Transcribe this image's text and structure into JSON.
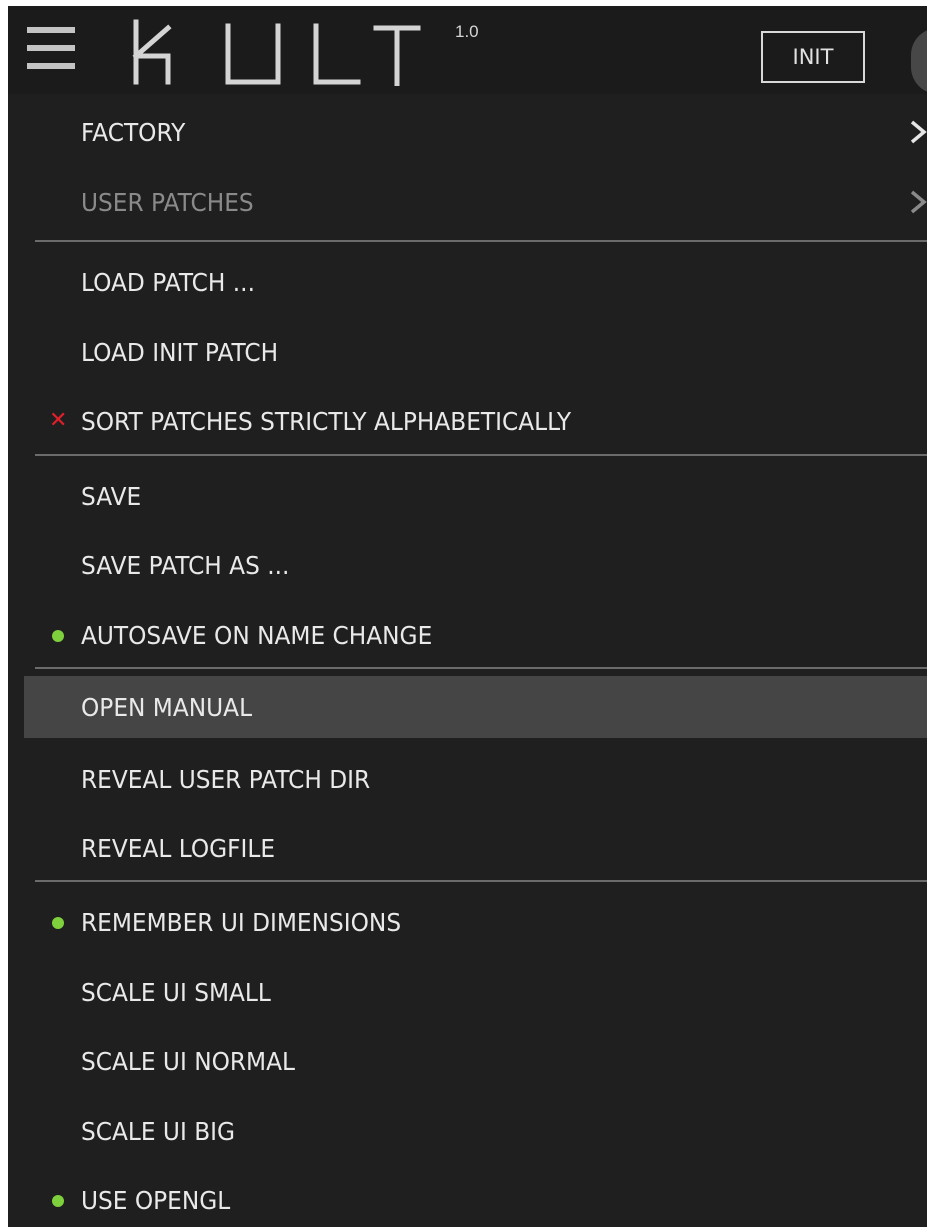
{
  "header": {
    "logo_text": "KULT",
    "version": "1.0",
    "init_label": "INIT"
  },
  "menu": {
    "factory": "FACTORY",
    "user_patches": "USER PATCHES",
    "load_patch": "LOAD PATCH ...",
    "load_init_patch": "LOAD INIT PATCH",
    "sort_patches": "SORT PATCHES STRICTLY ALPHABETICALLY",
    "save": "SAVE",
    "save_patch_as": "SAVE PATCH AS ...",
    "autosave": "AUTOSAVE ON NAME CHANGE",
    "open_manual": "OPEN MANUAL",
    "reveal_user_patch_dir": "REVEAL USER PATCH DIR",
    "reveal_logfile": "REVEAL LOGFILE",
    "remember_ui_dimensions": "REMEMBER UI DIMENSIONS",
    "scale_ui_small": "SCALE UI SMALL",
    "scale_ui_normal": "SCALE UI NORMAL",
    "scale_ui_big": "SCALE UI BIG",
    "use_opengl": "USE OPENGL"
  },
  "colors": {
    "background": "#1f1f1f",
    "highlight": "#454545",
    "enabled_dot": "#7ed13d",
    "disabled_x": "#e0202a"
  },
  "icons": {
    "menu": "hamburger-icon",
    "submenu": "chevron-right-icon",
    "enabled": "green-dot-icon",
    "disabled": "red-x-icon"
  }
}
